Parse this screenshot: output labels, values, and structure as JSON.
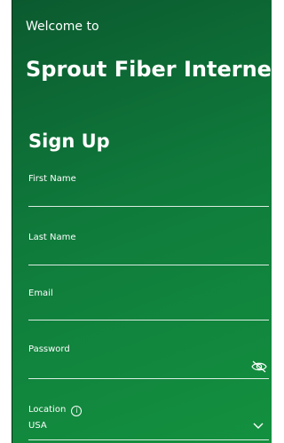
{
  "header": {
    "welcome": "Welcome to",
    "brand": "Sprout Fiber Internet"
  },
  "form": {
    "title": "Sign Up",
    "first_name_label": "First Name",
    "last_name_label": "Last Name",
    "email_label": "Email",
    "password_label": "Password",
    "location_label": "Location",
    "location_value": "USA",
    "info_icon": "i"
  },
  "icons": {
    "password_toggle": "eye-slash-icon",
    "location_info": "info-icon",
    "location_dropdown": "chevron-down-icon"
  }
}
